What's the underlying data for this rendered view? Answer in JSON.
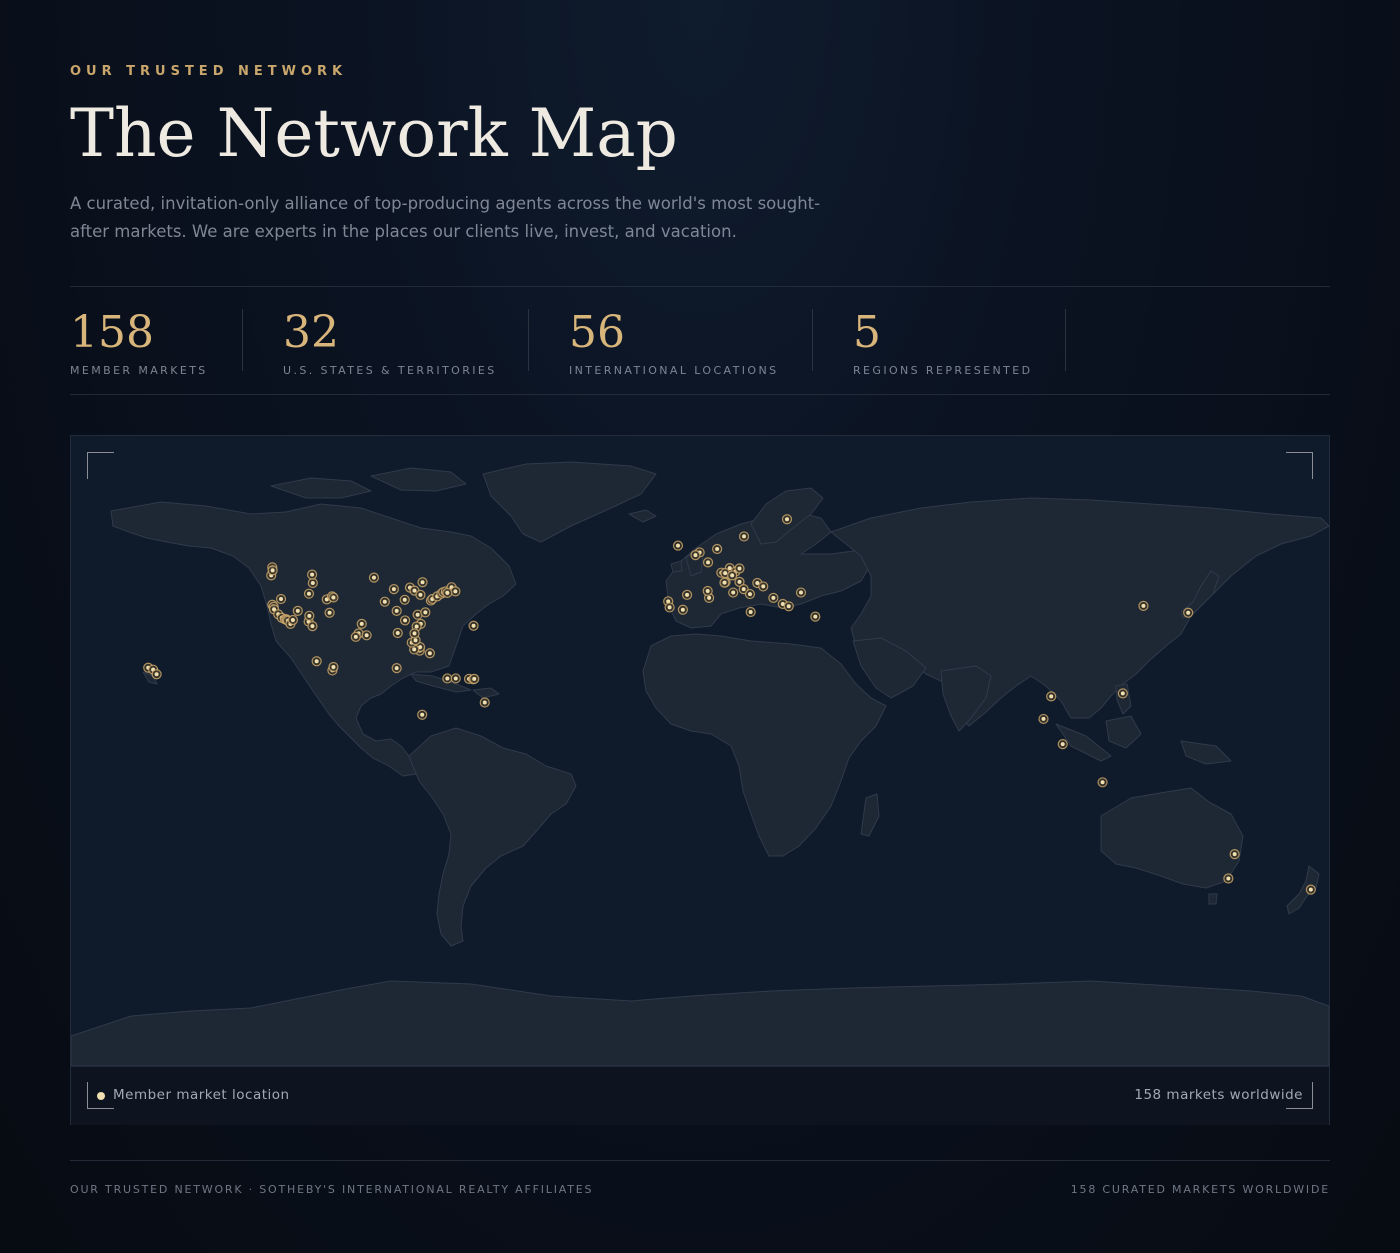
{
  "header": {
    "eyebrow": "OUR TRUSTED NETWORK",
    "title": "The Network Map",
    "subtitle": "A curated, invitation-only alliance of top-producing agents across the world's most sought-after markets. We are experts in the places our clients live, invest, and vacation."
  },
  "stats": [
    {
      "value": "158",
      "label": "MEMBER MARKETS"
    },
    {
      "value": "32",
      "label": "U.S. STATES & TERRITORIES"
    },
    {
      "value": "56",
      "label": "INTERNATIONAL LOCATIONS"
    },
    {
      "value": "5",
      "label": "REGIONS REPRESENTED"
    }
  ],
  "map": {
    "legend_label": "Member market location",
    "count_label": "158 markets worldwide",
    "colors": {
      "ocean": "#0f1a2b",
      "land": "#1e2734",
      "border": "#2f3a4a",
      "marker": "#f0dfb0",
      "marker_ring": "#c9a66b"
    },
    "markers": [
      {
        "lon": -122.4,
        "lat": 47.6
      },
      {
        "lon": -122.7,
        "lat": 45.5
      },
      {
        "lon": -122.3,
        "lat": 46.8
      },
      {
        "lon": -122.4,
        "lat": 37.8
      },
      {
        "lon": -122.0,
        "lat": 37.3
      },
      {
        "lon": -121.9,
        "lat": 36.6
      },
      {
        "lon": -120.7,
        "lat": 35.3
      },
      {
        "lon": -119.7,
        "lat": 34.4
      },
      {
        "lon": -118.8,
        "lat": 34.0
      },
      {
        "lon": -118.4,
        "lat": 34.0
      },
      {
        "lon": -118.2,
        "lat": 33.8
      },
      {
        "lon": -117.9,
        "lat": 33.6
      },
      {
        "lon": -117.2,
        "lat": 32.8
      },
      {
        "lon": -116.5,
        "lat": 33.8
      },
      {
        "lon": -119.9,
        "lat": 39.3
      },
      {
        "lon": -115.1,
        "lat": 36.2
      },
      {
        "lon": -112.0,
        "lat": 33.4
      },
      {
        "lon": -111.8,
        "lat": 34.9
      },
      {
        "lon": -111.9,
        "lat": 40.7
      },
      {
        "lon": -110.8,
        "lat": 43.5
      },
      {
        "lon": -106.8,
        "lat": 39.2
      },
      {
        "lon": -105.3,
        "lat": 40.0
      },
      {
        "lon": -104.9,
        "lat": 39.7
      },
      {
        "lon": -106.0,
        "lat": 35.7
      },
      {
        "lon": -111.0,
        "lat": 45.7
      },
      {
        "lon": -110.9,
        "lat": 32.2
      },
      {
        "lon": -97.7,
        "lat": 30.3
      },
      {
        "lon": -96.8,
        "lat": 32.8
      },
      {
        "lon": -95.4,
        "lat": 29.8
      },
      {
        "lon": -98.5,
        "lat": 29.4
      },
      {
        "lon": -93.3,
        "lat": 44.9
      },
      {
        "lon": -87.6,
        "lat": 41.9
      },
      {
        "lon": -90.2,
        "lat": 38.6
      },
      {
        "lon": -86.8,
        "lat": 36.2
      },
      {
        "lon": -84.4,
        "lat": 33.7
      },
      {
        "lon": -80.8,
        "lat": 35.2
      },
      {
        "lon": -79.9,
        "lat": 32.8
      },
      {
        "lon": -81.1,
        "lat": 32.1
      },
      {
        "lon": -78.6,
        "lat": 35.8
      },
      {
        "lon": -77.0,
        "lat": 38.9
      },
      {
        "lon": -76.6,
        "lat": 39.3
      },
      {
        "lon": -75.2,
        "lat": 40.0
      },
      {
        "lon": -74.0,
        "lat": 40.7
      },
      {
        "lon": -73.5,
        "lat": 41.1
      },
      {
        "lon": -72.7,
        "lat": 41.3
      },
      {
        "lon": -71.1,
        "lat": 42.4
      },
      {
        "lon": -70.0,
        "lat": 41.3
      },
      {
        "lon": -72.3,
        "lat": 40.9
      },
      {
        "lon": -80.2,
        "lat": 25.8
      },
      {
        "lon": -80.1,
        "lat": 26.7
      },
      {
        "lon": -81.8,
        "lat": 26.1
      },
      {
        "lon": -82.5,
        "lat": 27.9
      },
      {
        "lon": -81.4,
        "lat": 28.5
      },
      {
        "lon": -81.7,
        "lat": 30.3
      },
      {
        "lon": -86.5,
        "lat": 30.4
      },
      {
        "lon": -83.0,
        "lat": 42.3
      },
      {
        "lon": -84.5,
        "lat": 39.1
      },
      {
        "lon": -81.7,
        "lat": 41.5
      },
      {
        "lon": -79.4,
        "lat": 43.7
      },
      {
        "lon": -80.0,
        "lat": 40.4
      },
      {
        "lon": -157.9,
        "lat": 21.3
      },
      {
        "lon": -156.5,
        "lat": 20.8
      },
      {
        "lon": -155.5,
        "lat": 19.6
      },
      {
        "lon": -109.7,
        "lat": 23.0
      },
      {
        "lon": -105.2,
        "lat": 20.6
      },
      {
        "lon": -104.9,
        "lat": 21.5
      },
      {
        "lon": -86.8,
        "lat": 21.2
      },
      {
        "lon": -77.3,
        "lat": 25.1
      },
      {
        "lon": -64.8,
        "lat": 32.3
      },
      {
        "lon": -79.5,
        "lat": 9.0
      },
      {
        "lon": -72.3,
        "lat": 18.5
      },
      {
        "lon": -69.9,
        "lat": 18.5
      },
      {
        "lon": -66.1,
        "lat": 18.4
      },
      {
        "lon": -64.9,
        "lat": 18.3
      },
      {
        "lon": -61.6,
        "lat": 12.2
      },
      {
        "lon": -64.6,
        "lat": 18.4
      },
      {
        "lon": -6.3,
        "lat": 53.3
      },
      {
        "lon": -0.1,
        "lat": 51.5
      },
      {
        "lon": -1.3,
        "lat": 50.8
      },
      {
        "lon": 4.9,
        "lat": 52.4
      },
      {
        "lon": 12.6,
        "lat": 55.7
      },
      {
        "lon": 2.3,
        "lat": 48.9
      },
      {
        "lon": 7.3,
        "lat": 43.7
      },
      {
        "lon": 7.0,
        "lat": 43.6
      },
      {
        "lon": 8.5,
        "lat": 47.4
      },
      {
        "lon": 6.1,
        "lat": 46.2
      },
      {
        "lon": 7.2,
        "lat": 46.1
      },
      {
        "lon": 10.2,
        "lat": 46.5
      },
      {
        "lon": 11.3,
        "lat": 47.3
      },
      {
        "lon": 9.2,
        "lat": 45.5
      },
      {
        "lon": 11.3,
        "lat": 43.8
      },
      {
        "lon": 12.5,
        "lat": 41.9
      },
      {
        "lon": 14.3,
        "lat": 40.6
      },
      {
        "lon": 9.5,
        "lat": 41.0
      },
      {
        "lon": 16.4,
        "lat": 43.5
      },
      {
        "lon": 18.1,
        "lat": 42.6
      },
      {
        "lon": 23.7,
        "lat": 38.0
      },
      {
        "lon": 25.4,
        "lat": 37.4
      },
      {
        "lon": 21.0,
        "lat": 39.6
      },
      {
        "lon": 28.9,
        "lat": 41.0
      },
      {
        "lon": 33.0,
        "lat": 34.7
      },
      {
        "lon": 14.5,
        "lat": 35.9
      },
      {
        "lon": 2.6,
        "lat": 39.6
      },
      {
        "lon": -3.7,
        "lat": 40.4
      },
      {
        "lon": 2.2,
        "lat": 41.4
      },
      {
        "lon": -4.9,
        "lat": 36.5
      },
      {
        "lon": -9.1,
        "lat": 38.7
      },
      {
        "lon": -8.7,
        "lat": 37.1
      },
      {
        "lon": 24.9,
        "lat": 60.2
      },
      {
        "lon": 126.9,
        "lat": 37.5
      },
      {
        "lon": 139.7,
        "lat": 35.7
      },
      {
        "lon": 121.0,
        "lat": 14.6
      },
      {
        "lon": 100.5,
        "lat": 13.8
      },
      {
        "lon": 98.3,
        "lat": 7.9
      },
      {
        "lon": 103.8,
        "lat": 1.3
      },
      {
        "lon": 115.2,
        "lat": -8.7
      },
      {
        "lon": 151.2,
        "lat": -33.9
      },
      {
        "lon": 153.0,
        "lat": -27.5
      },
      {
        "lon": 174.8,
        "lat": -36.8
      }
    ]
  }
}
